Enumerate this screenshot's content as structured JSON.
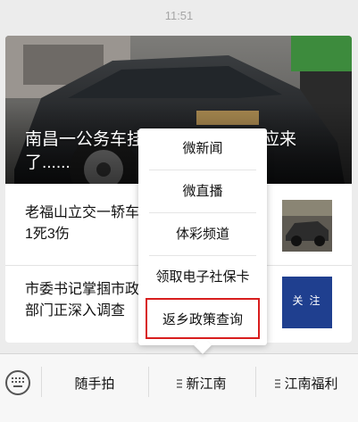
{
  "status_bar": {
    "time": "11:51"
  },
  "feed": {
    "hero": {
      "title": "南昌一公务车挂　　　　　　回应来了......"
    },
    "items": [
      {
        "text": "老福山立交一轿车\n1死3伤"
      },
      {
        "text": "市委书记掌掴市政\n部门正深入调查",
        "thumb_text": "关 注"
      }
    ]
  },
  "popup_menu": {
    "items": [
      {
        "label": "微新闻"
      },
      {
        "label": "微直播"
      },
      {
        "label": "体彩频道"
      },
      {
        "label": "领取电子社保卡"
      },
      {
        "label": "返乡政策查询",
        "highlighted": true
      }
    ],
    "highlight_color": "#d81e1e"
  },
  "bottom_bar": {
    "items": [
      {
        "label": "随手拍",
        "has_submenu": false
      },
      {
        "label": "新江南",
        "has_submenu": true
      },
      {
        "label": "江南福利",
        "has_submenu": true
      }
    ]
  }
}
